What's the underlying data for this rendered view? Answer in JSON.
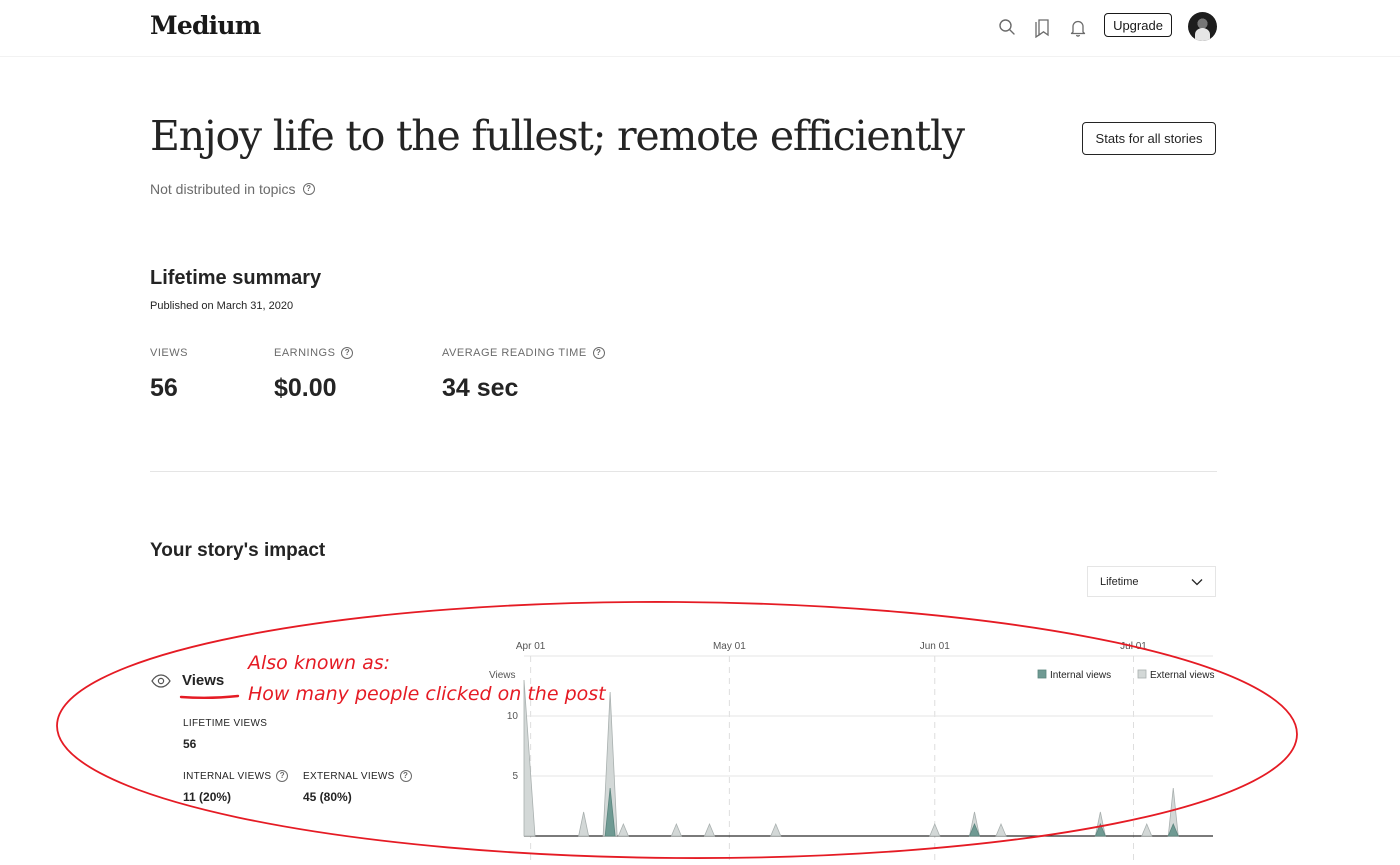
{
  "header": {
    "logo": "Medium",
    "upgrade_label": "Upgrade",
    "icons": [
      "search-icon",
      "bookmark-icon",
      "bell-icon",
      "avatar"
    ]
  },
  "story": {
    "title": "Enjoy life to the fullest; remote efficiently",
    "topics_status": "Not distributed in topics",
    "stats_button_label": "Stats for all stories"
  },
  "lifetime_summary": {
    "heading": "Lifetime summary",
    "published": "Published on March 31, 2020",
    "metrics": [
      {
        "label": "VIEWS",
        "value": "56"
      },
      {
        "label": "EARNINGS",
        "value": "$0.00"
      },
      {
        "label": "AVERAGE READING TIME",
        "value": "34 sec"
      }
    ]
  },
  "impact": {
    "heading": "Your story's impact",
    "period_selected": "Lifetime",
    "views": {
      "title": "Views",
      "lifetime_label": "LIFETIME VIEWS",
      "lifetime_value": "56",
      "internal_label": "INTERNAL VIEWS",
      "internal_value": "11 (20%)",
      "external_label": "EXTERNAL VIEWS",
      "external_value": "45 (80%)"
    }
  },
  "annotation": {
    "line1": "Also known as:",
    "line2": "How many people clicked on the post",
    "color": "#e51b24"
  },
  "colors": {
    "internal": "#6f9a93",
    "external": "#d3d8d7",
    "external_stroke": "#a9b0af"
  },
  "chart_data": {
    "type": "area",
    "ylabel": "Views",
    "ylim": [
      0,
      15
    ],
    "y_ticks": [
      5,
      10
    ],
    "x_range": [
      "2020-03-31",
      "2020-07-13"
    ],
    "x_ticks": [
      {
        "date": "2020-04-01",
        "label": "Apr 01"
      },
      {
        "date": "2020-05-01",
        "label": "May 01"
      },
      {
        "date": "2020-06-01",
        "label": "Jun 01"
      },
      {
        "date": "2020-07-01",
        "label": "Jul 01"
      }
    ],
    "legend": {
      "position": "top-right",
      "entries": [
        "Internal views",
        "External views"
      ]
    },
    "series": [
      {
        "name": "External views",
        "points": [
          {
            "date": "2020-03-31",
            "value": 13
          },
          {
            "date": "2020-04-09",
            "value": 2
          },
          {
            "date": "2020-04-13",
            "value": 12
          },
          {
            "date": "2020-04-15",
            "value": 1
          },
          {
            "date": "2020-04-23",
            "value": 1
          },
          {
            "date": "2020-04-28",
            "value": 1
          },
          {
            "date": "2020-05-08",
            "value": 1
          },
          {
            "date": "2020-06-01",
            "value": 1
          },
          {
            "date": "2020-06-07",
            "value": 2
          },
          {
            "date": "2020-06-11",
            "value": 1
          },
          {
            "date": "2020-06-26",
            "value": 2
          },
          {
            "date": "2020-07-03",
            "value": 1
          },
          {
            "date": "2020-07-07",
            "value": 4
          }
        ]
      },
      {
        "name": "Internal views",
        "points": [
          {
            "date": "2020-04-13",
            "value": 4
          },
          {
            "date": "2020-06-07",
            "value": 1
          },
          {
            "date": "2020-06-26",
            "value": 1
          },
          {
            "date": "2020-07-07",
            "value": 1
          }
        ]
      }
    ]
  }
}
